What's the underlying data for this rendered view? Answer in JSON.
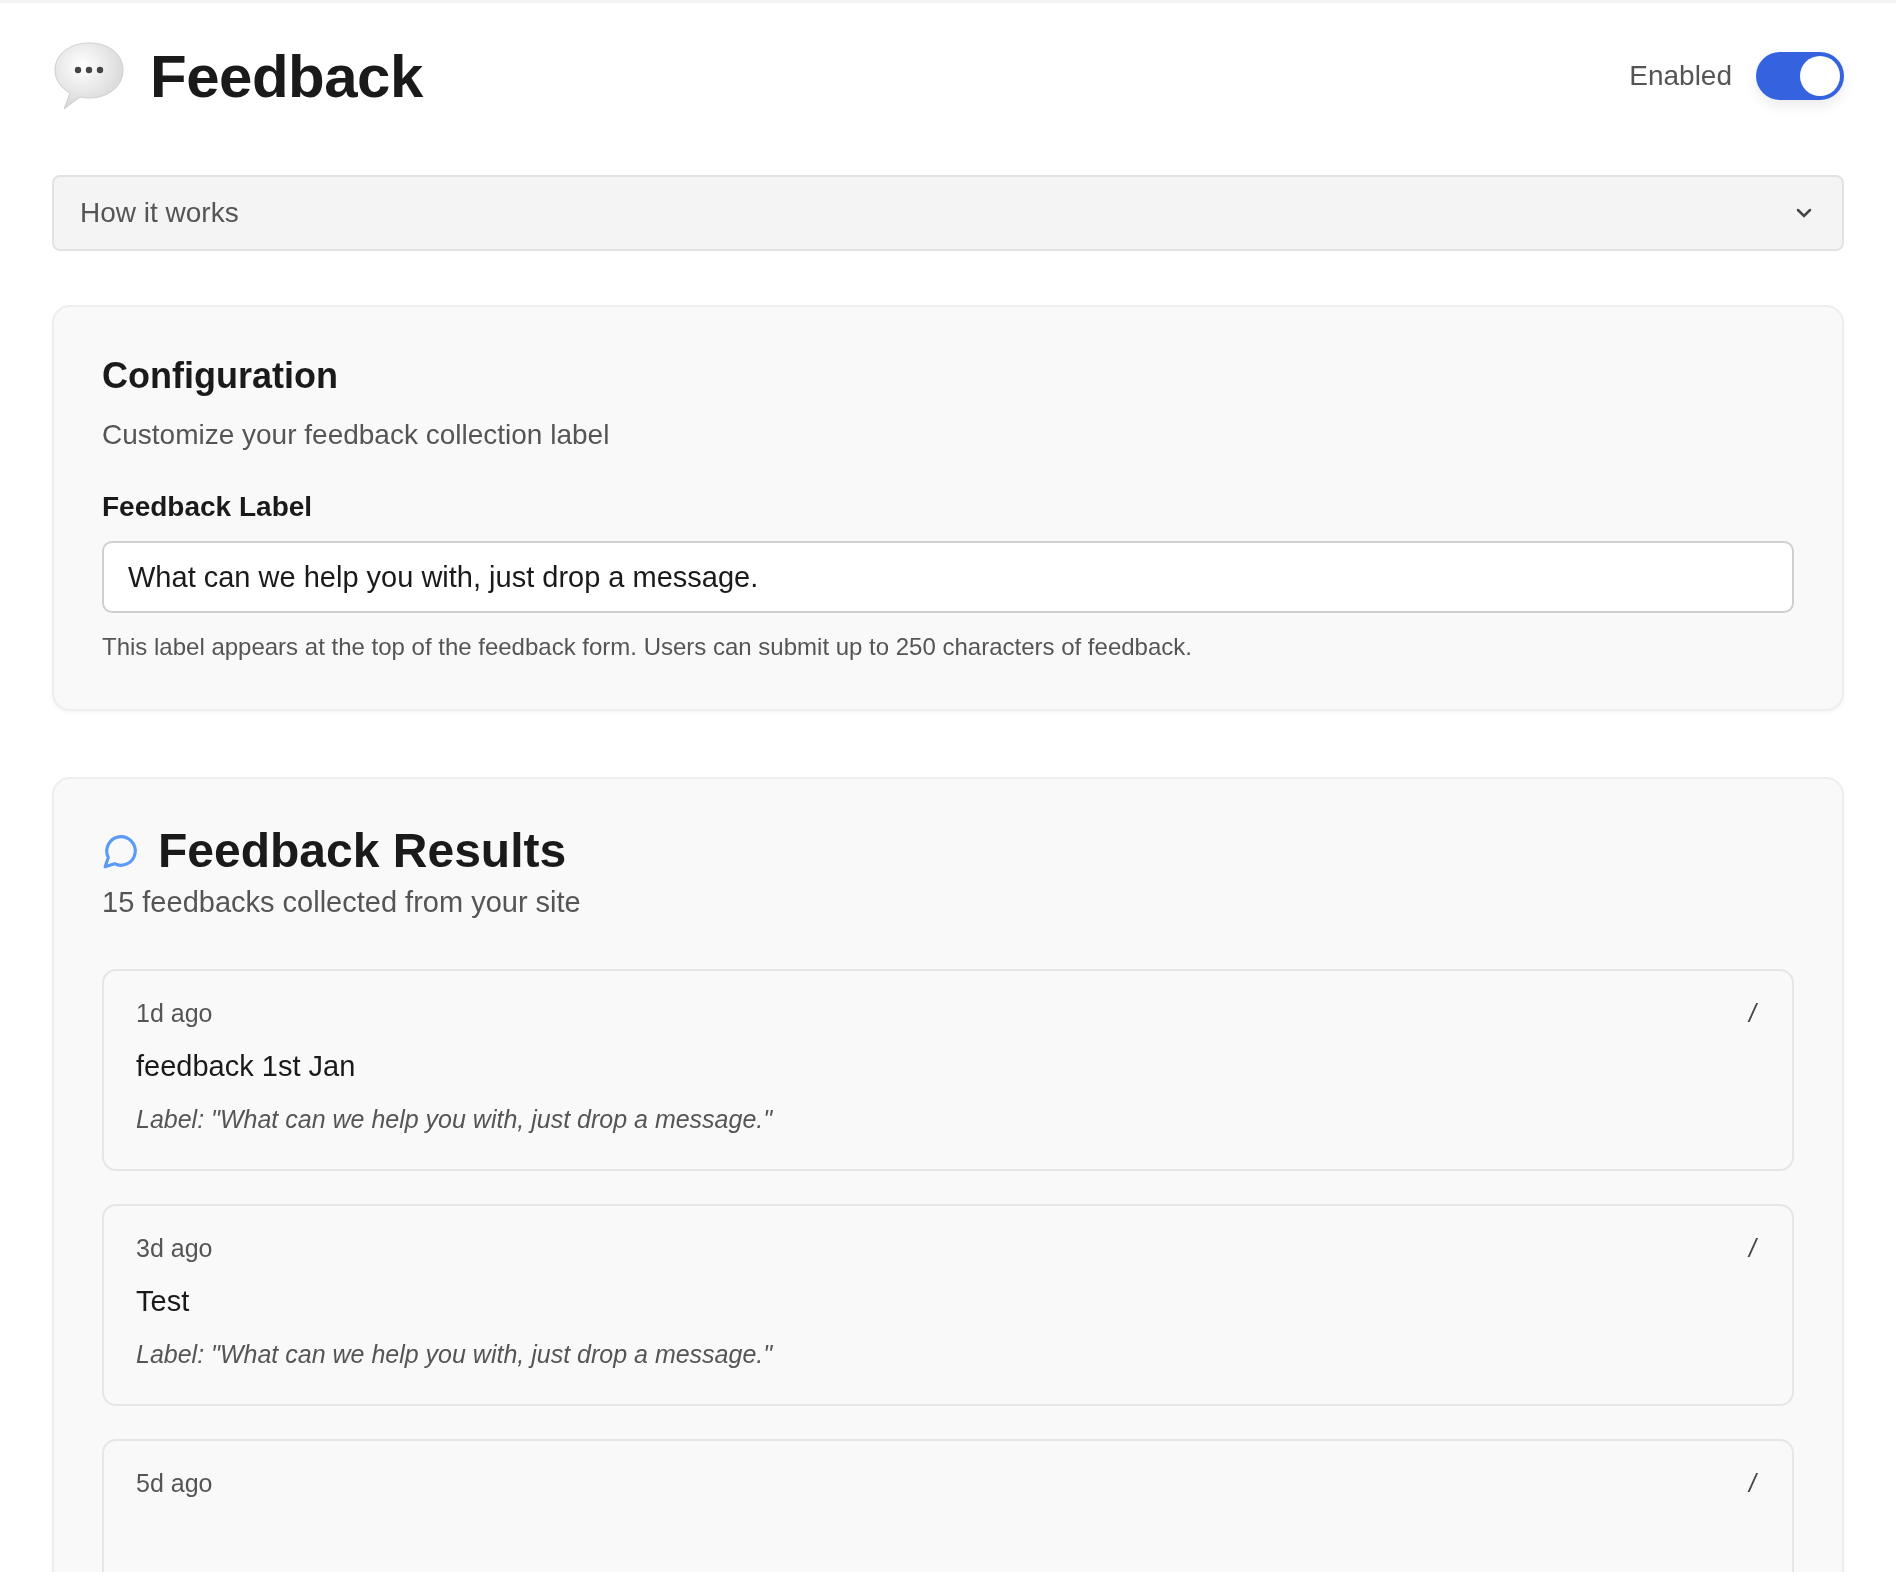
{
  "header": {
    "title": "Feedback",
    "toggle_label": "Enabled",
    "enabled": true
  },
  "accordion": {
    "title": "How it works",
    "expanded": false
  },
  "configuration": {
    "title": "Configuration",
    "subtitle": "Customize your feedback collection label",
    "field_label": "Feedback Label",
    "value": "What can we help you with, just drop a message.",
    "help": "This label appears at the top of the feedback form. Users can submit up to 250 characters of feedback."
  },
  "results": {
    "title": "Feedback Results",
    "subtitle": "15 feedbacks collected from your site",
    "items": [
      {
        "time": "1d ago",
        "action": "/",
        "message": "feedback 1st Jan",
        "label": "Label: \"What can we help you with, just drop a message.\""
      },
      {
        "time": "3d ago",
        "action": "/",
        "message": "Test",
        "label": "Label: \"What can we help you with, just drop a message.\""
      },
      {
        "time": "5d ago",
        "action": "/"
      }
    ]
  }
}
